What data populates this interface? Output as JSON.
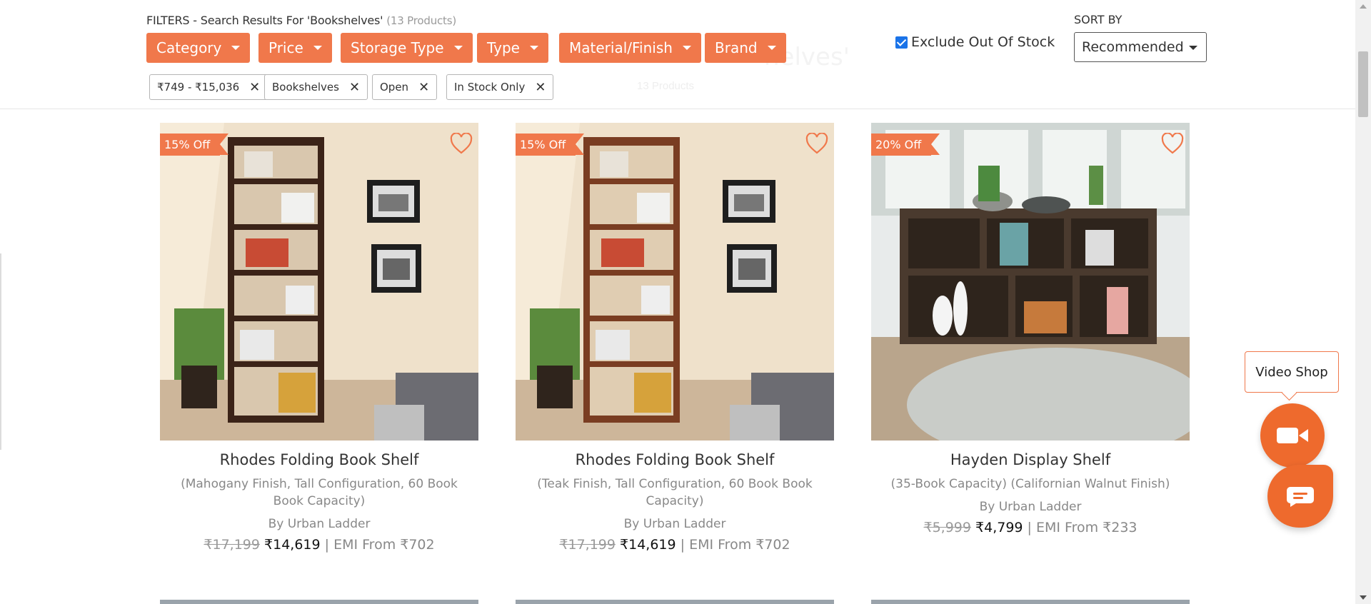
{
  "background_header": {
    "title": "helves'",
    "subtitle": "13 Products"
  },
  "filters": {
    "heading": "FILTERS - Search Results For 'Bookshelves'",
    "count": "(13 Products)",
    "buttons": [
      {
        "label": "Category"
      },
      {
        "label": "Price"
      },
      {
        "label": "Storage Type"
      },
      {
        "label": "Type"
      },
      {
        "label": "Material/Finish"
      },
      {
        "label": "Brand"
      }
    ],
    "applied": [
      {
        "label": "₹749 - ₹15,036"
      },
      {
        "label": "Bookshelves"
      },
      {
        "label": "Open"
      },
      {
        "label": "In Stock Only"
      }
    ],
    "exclude_out_of_stock": {
      "label": "Exclude Out Of Stock",
      "checked": true
    },
    "sort": {
      "label": "SORT BY",
      "value": "Recommended"
    }
  },
  "products": [
    {
      "badge": "15% Off",
      "name": "Rhodes Folding Book Shelf",
      "desc": "(Mahogany Finish, Tall Configuration, 60 Book Book Capacity)",
      "brand": "By Urban Ladder",
      "mrp": "₹17,199",
      "price": "₹14,619",
      "emi": "| EMI From ₹702"
    },
    {
      "badge": "15% Off",
      "name": "Rhodes Folding Book Shelf",
      "desc": "(Teak Finish, Tall Configuration, 60 Book Book Capacity)",
      "brand": "By Urban Ladder",
      "mrp": "₹17,199",
      "price": "₹14,619",
      "emi": "| EMI From ₹702"
    },
    {
      "badge": "20% Off",
      "name": "Hayden Display Shelf",
      "desc": "(35-Book Capacity) (Californian Walnut Finish)",
      "brand": "By Urban Ladder",
      "mrp": "₹5,999",
      "price": "₹4,799",
      "emi": "| EMI From ₹233"
    }
  ],
  "widgets": {
    "video_shop": "Video Shop"
  },
  "colors": {
    "accent": "#f0784b",
    "fab": "#ee6a2d",
    "checkbox": "#1a73e8"
  }
}
